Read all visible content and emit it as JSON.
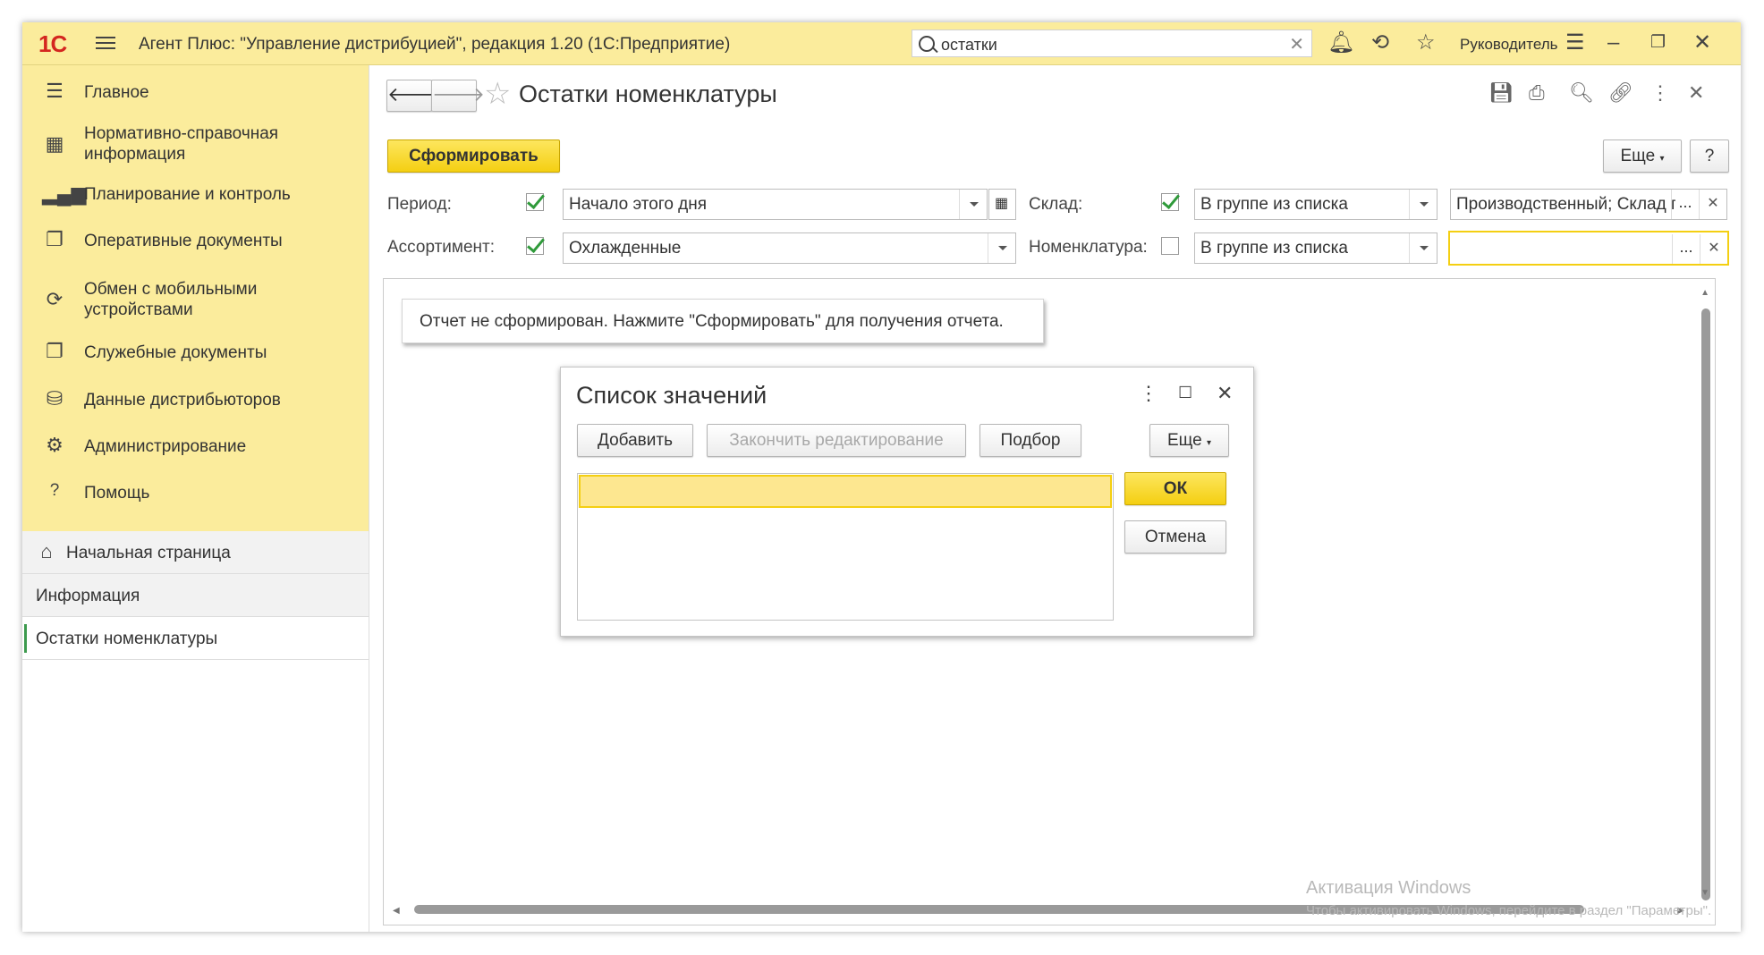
{
  "titlebar": {
    "logo": "1С",
    "app_title": "Агент Плюс: \"Управление дистрибуцией\", редакция 1.20  (1С:Предприятие)",
    "search_value": "остатки",
    "user_name": "Руководитель"
  },
  "sidebar": {
    "sections": [
      {
        "label": "Главное",
        "icon": "menu-icon"
      },
      {
        "label": "Нормативно-справочная информация",
        "icon": "grid-icon"
      },
      {
        "label": "Планирование и контроль",
        "icon": "bar-chart-icon"
      },
      {
        "label": "Оперативные документы",
        "icon": "documents-icon"
      },
      {
        "label": "Обмен с мобильными устройствами",
        "icon": "sync-icon"
      },
      {
        "label": "Служебные документы",
        "icon": "documents-icon"
      },
      {
        "label": "Данные дистрибьюторов",
        "icon": "data-icon"
      },
      {
        "label": "Администрирование",
        "icon": "gear-icon"
      },
      {
        "label": "Помощь",
        "icon": "help-icon"
      }
    ],
    "opened": [
      {
        "label": "Начальная страница",
        "icon": "home-icon"
      },
      {
        "label": "Информация"
      },
      {
        "label": "Остатки номенклатуры"
      }
    ]
  },
  "form": {
    "title": "Остатки номенклатуры",
    "generate_label": "Сформировать",
    "more_label": "Еще",
    "help_label": "?",
    "period_label": "Период:",
    "period_value": "Начало этого дня",
    "warehouse_label": "Склад:",
    "warehouse_mode": "В группе из списка",
    "warehouse_value": "Производственный; Склад г",
    "assortment_label": "Ассортимент:",
    "assortment_value": "Охлажденные",
    "nomenclature_label": "Номенклатура:",
    "nomenclature_mode": "В группе из списка",
    "nomenclature_value": "",
    "period_checked": true,
    "warehouse_checked": true,
    "assortment_checked": true,
    "nomenclature_checked": false,
    "report_message": "Отчет не сформирован. Нажмите \"Сформировать\" для получения отчета.",
    "watermark_title": "Активация Windows",
    "watermark_text": "Чтобы активировать Windows, перейдите в раздел \"Параметры\"."
  },
  "dialog": {
    "title": "Список значений",
    "add_label": "Добавить",
    "finish_label": "Закончить редактирование",
    "pick_label": "Подбор",
    "more_label": "Еще",
    "ok_label": "ОК",
    "cancel_label": "Отмена"
  },
  "colors": {
    "accent_yellow": "#fbec9c",
    "button_yellow": "#f4cf12",
    "check_green": "#2f9a3a",
    "logo_red": "#d4261f"
  }
}
